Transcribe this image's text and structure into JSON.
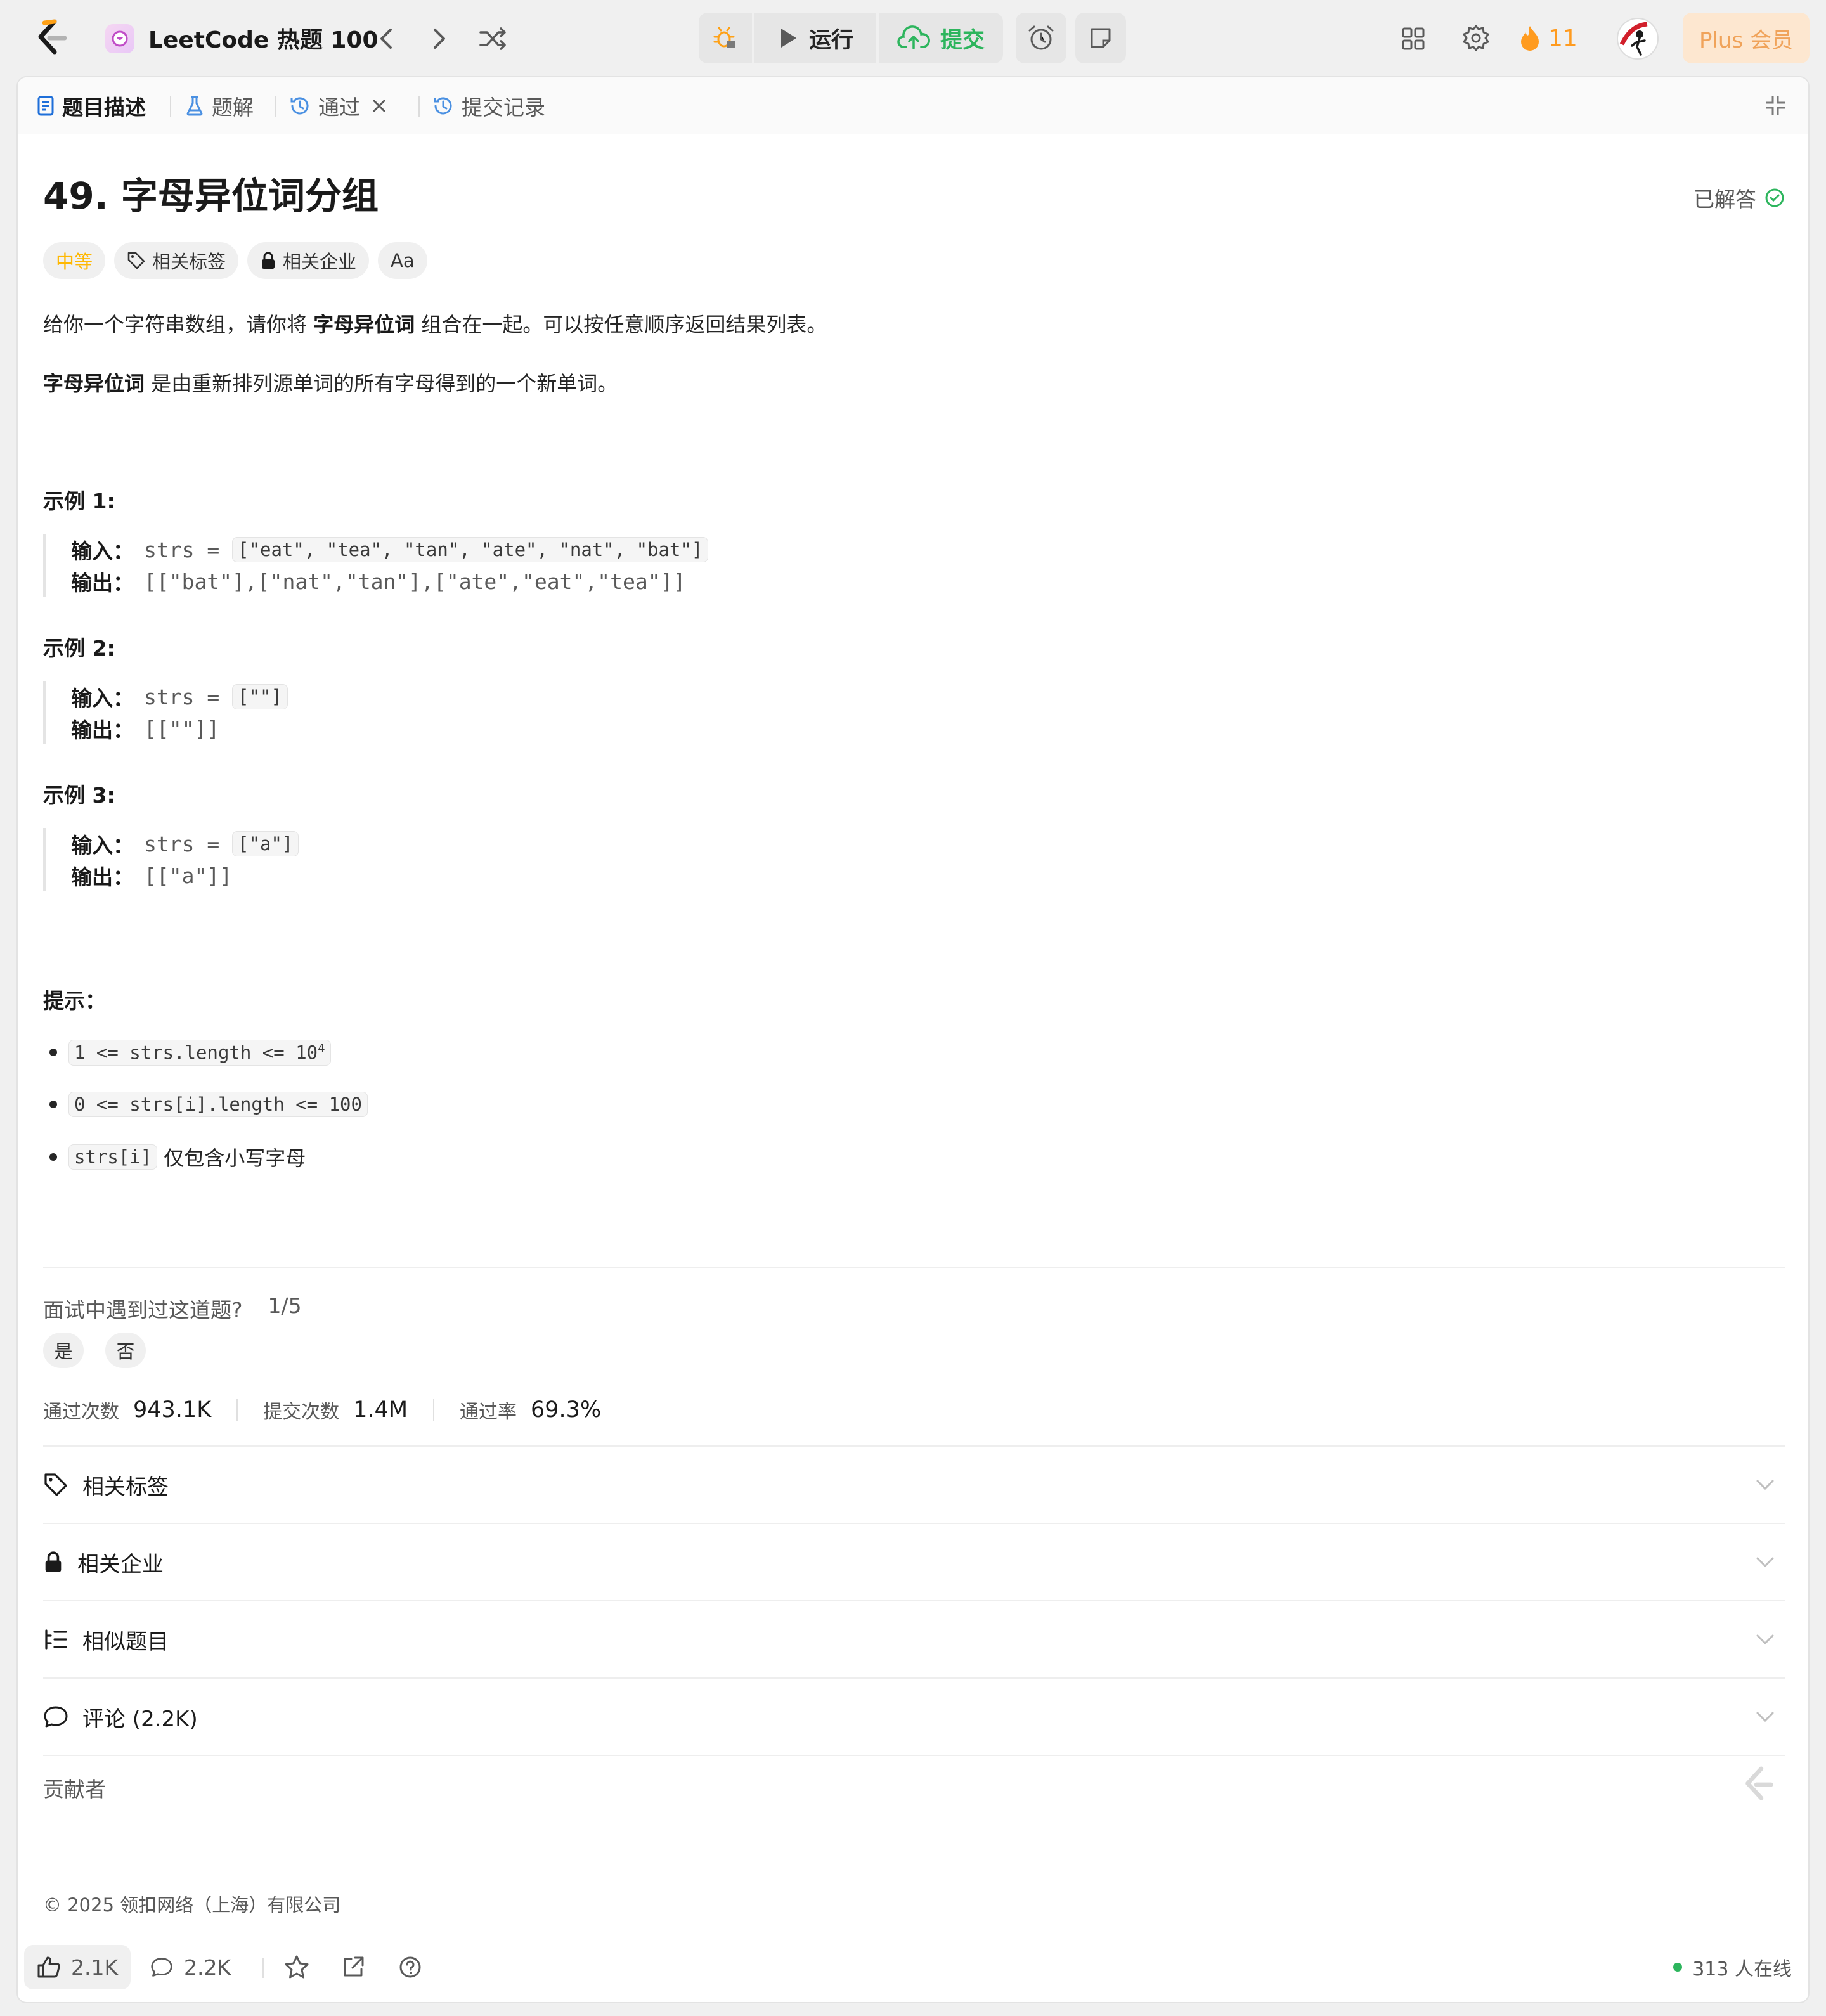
{
  "topbar": {
    "list_title": "LeetCode 热题 100",
    "run_label": "运行",
    "submit_label": "提交",
    "streak_count": "11",
    "plus_label": "Plus 会员"
  },
  "tabs": [
    {
      "label": "题目描述"
    },
    {
      "label": "题解"
    },
    {
      "label": "通过"
    },
    {
      "label": "提交记录"
    }
  ],
  "problem": {
    "title": "49. 字母异位词分组",
    "status": "已解答",
    "difficulty": "中等",
    "chips": [
      "相关标签",
      "相关企业",
      "Aa"
    ],
    "desc1_pre": "给你一个字符串数组，请你将 ",
    "desc1_bold": "字母异位词",
    "desc1_post": " 组合在一起。可以按任意顺序返回结果列表。",
    "desc2_bold": "字母异位词",
    "desc2_post": " 是由重新排列源单词的所有字母得到的一个新单词。"
  },
  "examples": [
    {
      "heading": "示例 1:",
      "in_label": "输入：",
      "in_var": "strs = ",
      "in_code": "[\"eat\", \"tea\", \"tan\", \"ate\", \"nat\", \"bat\"]",
      "out_label": "输出：",
      "out_val": "[[\"bat\"],[\"nat\",\"tan\"],[\"ate\",\"eat\",\"tea\"]]"
    },
    {
      "heading": "示例 2:",
      "in_label": "输入：",
      "in_var": "strs = ",
      "in_code": "[\"\"]",
      "out_label": "输出：",
      "out_val": "[[\"\"]]"
    },
    {
      "heading": "示例 3:",
      "in_label": "输入：",
      "in_var": "strs = ",
      "in_code": "[\"a\"]",
      "out_label": "输出：",
      "out_val": "[[\"a\"]]"
    }
  ],
  "hints": {
    "heading": "提示：",
    "items": [
      {
        "code": "1 <= strs.length <= 10",
        "sup": "4",
        "text": ""
      },
      {
        "code": "0 <= strs[i].length <= 100",
        "sup": "",
        "text": ""
      },
      {
        "code": "strs[i]",
        "sup": "",
        "text": " 仅包含小写字母"
      }
    ]
  },
  "interview": {
    "question": "面试中遇到过这道题?",
    "count": "1/5",
    "yes": "是",
    "no": "否"
  },
  "stats": [
    {
      "label": "通过次数",
      "value": "943.1K"
    },
    {
      "label": "提交次数",
      "value": "1.4M"
    },
    {
      "label": "通过率",
      "value": "69.3%"
    }
  ],
  "accordions": [
    {
      "label": "相关标签",
      "icon": "tag-icon"
    },
    {
      "label": "相关企业",
      "icon": "lock-icon"
    },
    {
      "label": "相似题目",
      "icon": "list-icon"
    },
    {
      "label": "评论 (2.2K)",
      "icon": "comment-icon"
    }
  ],
  "contributors": "贡献者",
  "copyright": "© 2025 领扣网络（上海）有限公司",
  "bottombar": {
    "likes": "2.1K",
    "comments": "2.2K",
    "online": "313 人在线"
  },
  "colors": {
    "accent_green": "#2db55d",
    "difficulty_medium": "#ffb800",
    "streak_orange": "#ff9b1f",
    "plus_bg": "#fde7d0"
  }
}
